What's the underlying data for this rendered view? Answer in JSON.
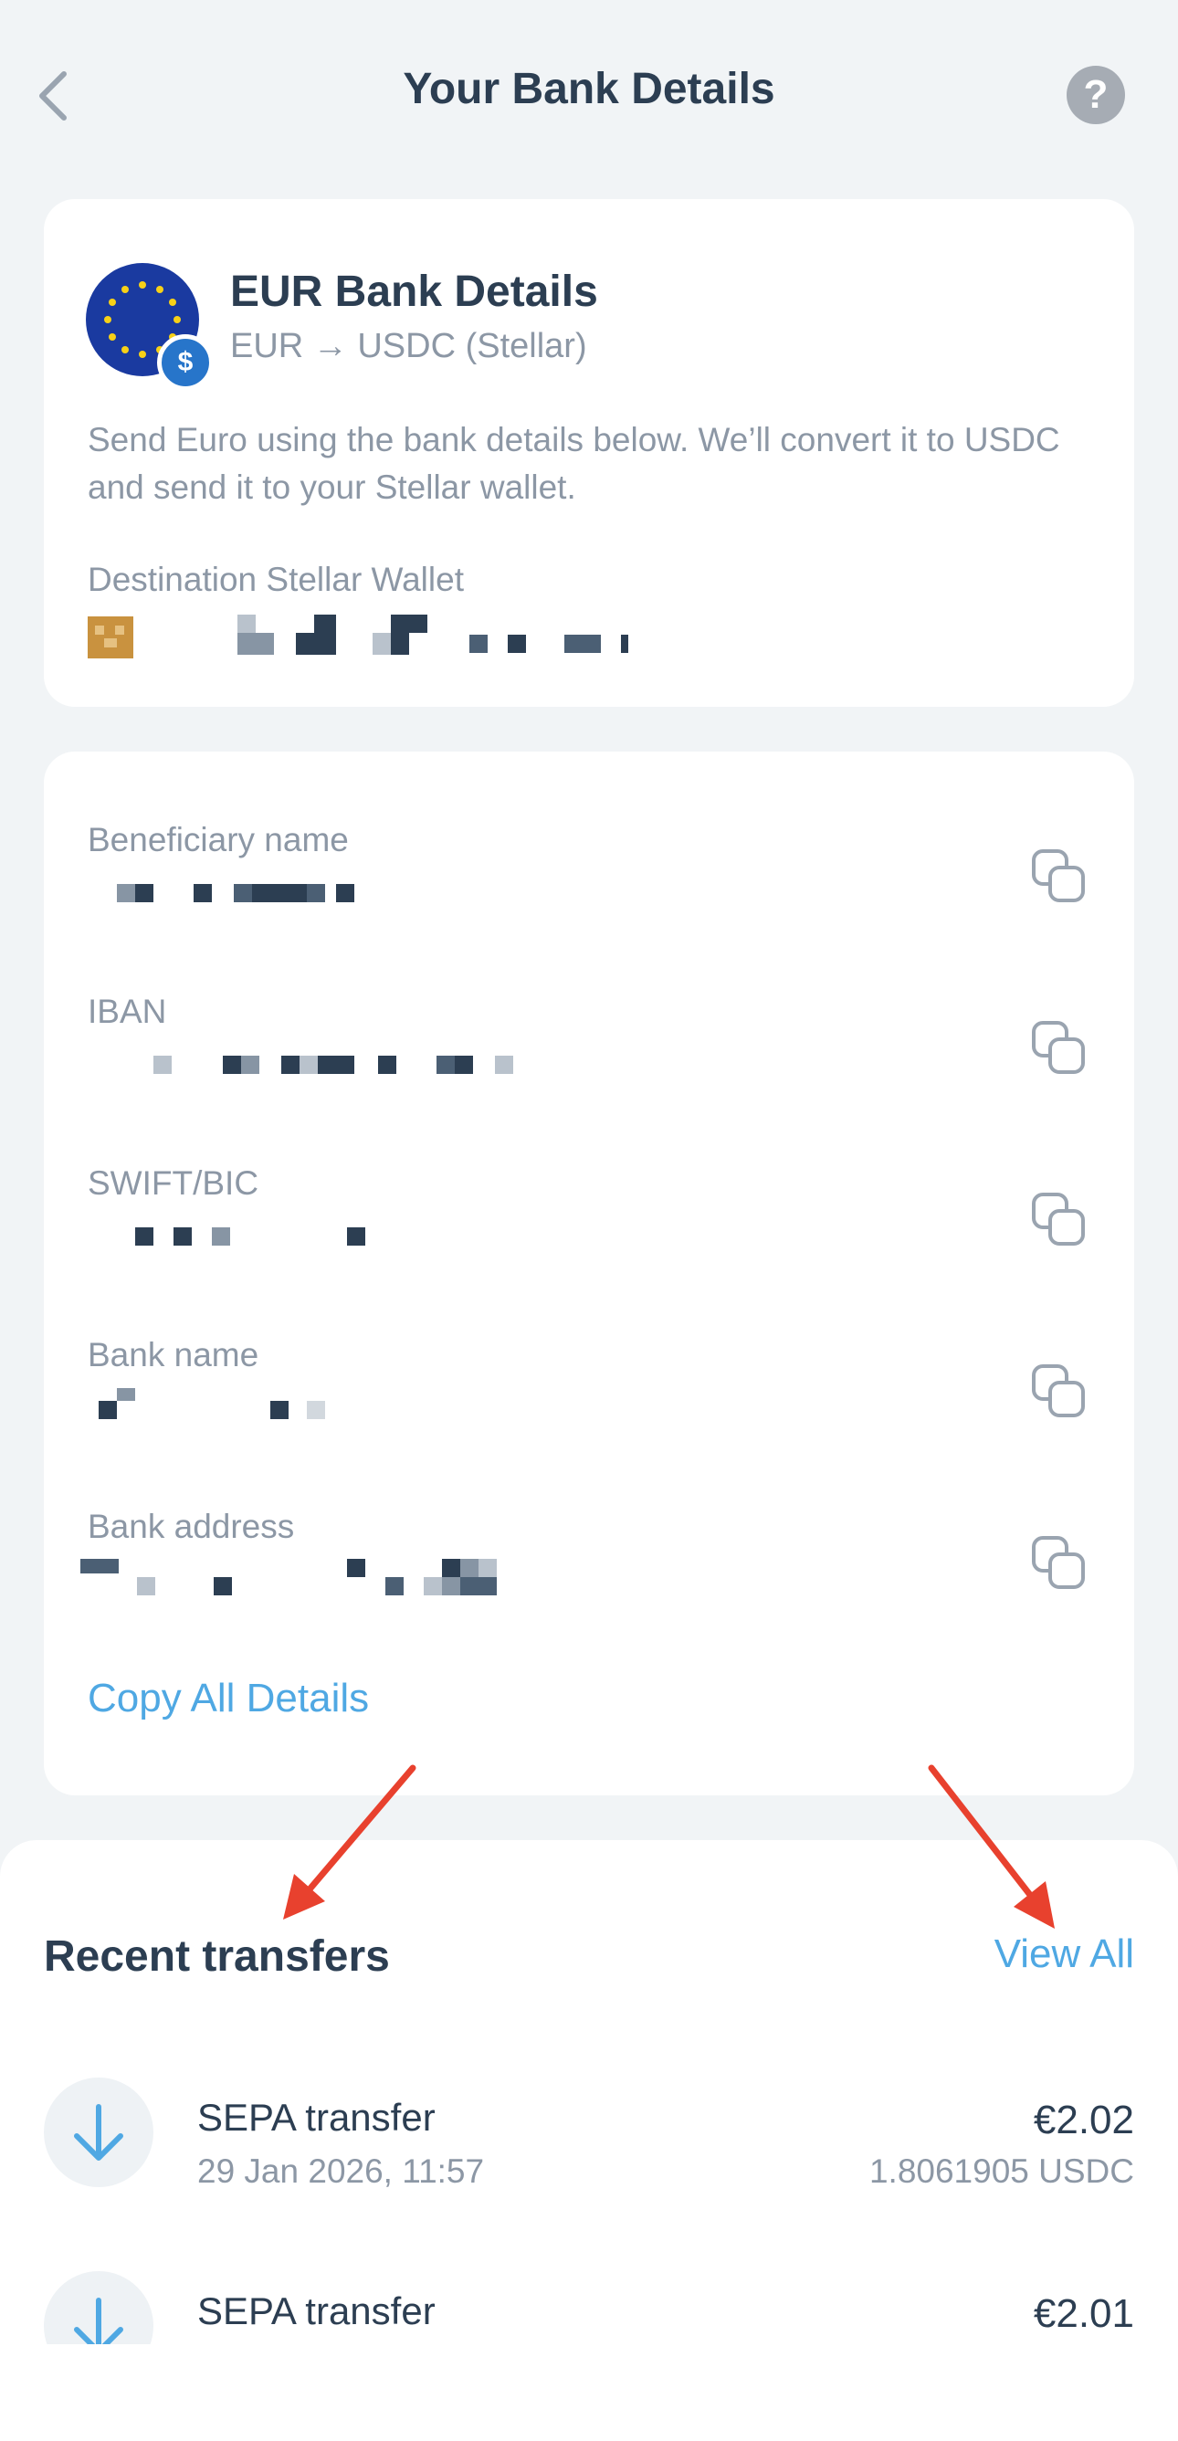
{
  "header": {
    "title": "Your Bank Details",
    "help_label": "?"
  },
  "account_card": {
    "title": "EUR Bank Details",
    "subtitle": "EUR → USDC (Stellar)",
    "description": "Send Euro using the bank details below. We’ll convert it to USDC and send it to your Stellar wallet.",
    "destination_label": "Destination Stellar Wallet",
    "badge_symbol": "$"
  },
  "details": {
    "fields": [
      {
        "label": "Beneficiary name"
      },
      {
        "label": "IBAN"
      },
      {
        "label": "SWIFT/BIC"
      },
      {
        "label": "Bank name"
      },
      {
        "label": "Bank address"
      }
    ],
    "copy_all_label": "Copy All Details"
  },
  "recent": {
    "title": "Recent transfers",
    "view_all_label": "View All",
    "transfers": [
      {
        "title": "SEPA transfer",
        "date": "29 Jan 2026, 11:57",
        "amount": "€2.02",
        "converted": "1.8061905 USDC"
      },
      {
        "title": "SEPA transfer",
        "date": "",
        "amount": "€2.01",
        "converted": ""
      }
    ]
  },
  "colors": {
    "accent": "#4fa8e3",
    "annotation_arrow": "#e8412e",
    "eu_blue": "#1a3aa0",
    "usdc_blue": "#2775ca"
  }
}
